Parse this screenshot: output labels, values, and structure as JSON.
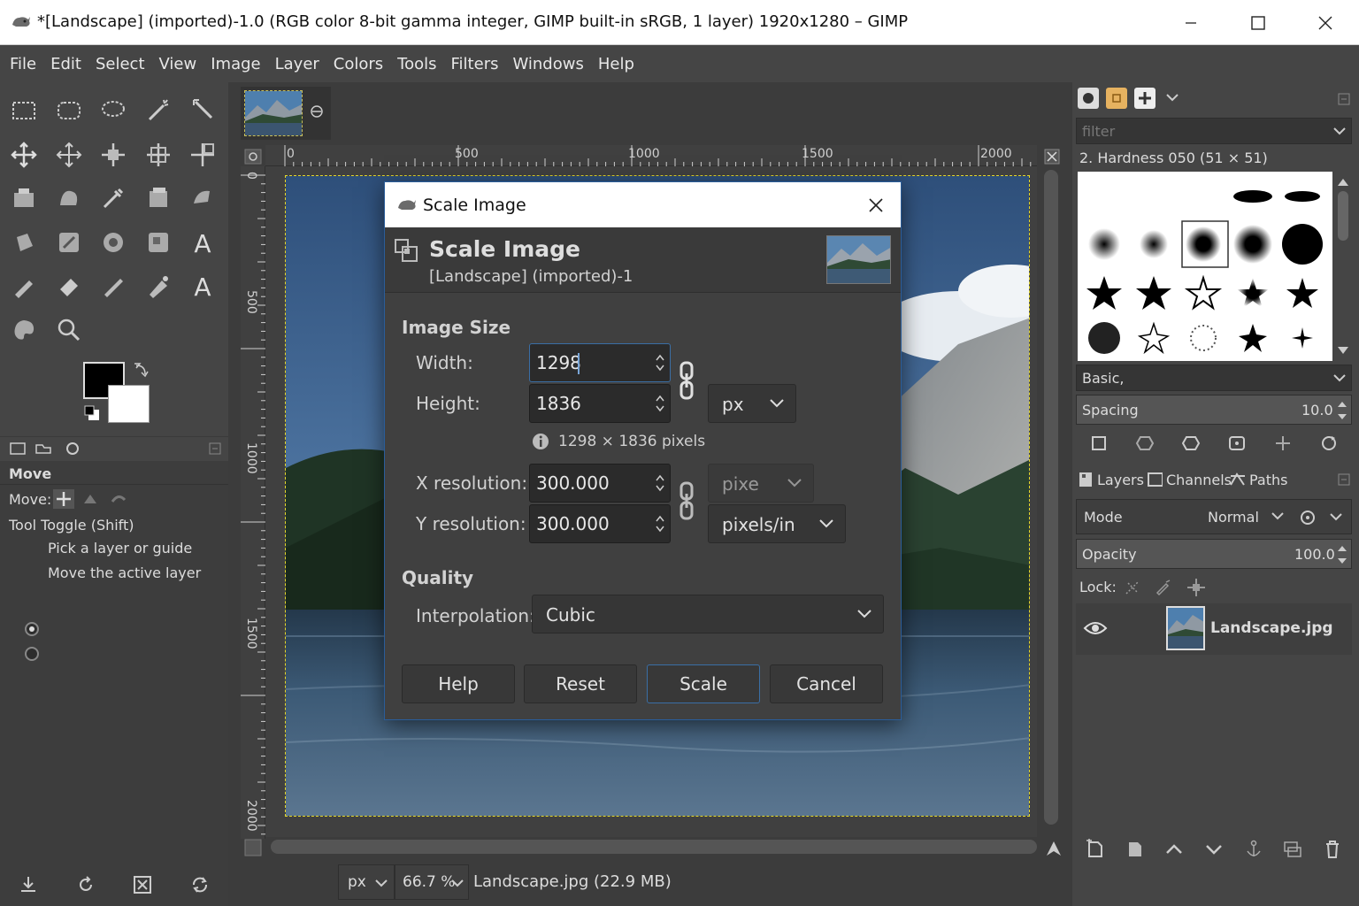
{
  "window": {
    "title": "*[Landscape] (imported)-1.0 (RGB color 8-bit gamma integer, GIMP built-in sRGB, 1 layer) 1920x1280 – GIMP"
  },
  "menu": [
    "File",
    "Edit",
    "Select",
    "View",
    "Image",
    "Layer",
    "Colors",
    "Tools",
    "Filters",
    "Windows",
    "Help"
  ],
  "tool_options": {
    "title": "Move",
    "move_label": "Move:",
    "toggle_label": "Tool Toggle (Shift)",
    "options": [
      {
        "label": "Pick a layer or guide",
        "selected": true
      },
      {
        "label": "Move the active layer",
        "selected": false
      }
    ]
  },
  "ruler": {
    "h_labels": [
      "0",
      "500",
      "1000",
      "1500",
      "2000"
    ],
    "v_labels": [
      "0",
      "500",
      "1000",
      "1500",
      "2000"
    ]
  },
  "status": {
    "unit": "px",
    "zoom": "66.7 %",
    "file_info": "Landscape.jpg (22.9 MB)"
  },
  "brushes": {
    "filter_placeholder": "filter",
    "current_brush": "2. Hardness 050 (51 × 51)",
    "preset": "Basic,",
    "spacing_label": "Spacing",
    "spacing_value": "10.0"
  },
  "layers": {
    "tabs": [
      {
        "label": "Layers",
        "icon": "layers-icon"
      },
      {
        "label": "Channels",
        "icon": "channels-icon"
      },
      {
        "label": "Paths",
        "icon": "paths-icon"
      }
    ],
    "mode_label": "Mode",
    "mode_value": "Normal",
    "opacity_label": "Opacity",
    "opacity_value": "100.0",
    "lock_label": "Lock:",
    "items": [
      {
        "name": "Landscape.jpg",
        "visible": true
      }
    ]
  },
  "dialog": {
    "window_title": "Scale Image",
    "header_title": "Scale Image",
    "header_subtitle": "[Landscape] (imported)-1",
    "image_size_label": "Image Size",
    "width_label": "Width:",
    "width_value": "1298",
    "height_label": "Height:",
    "height_value": "1836",
    "size_unit": "px",
    "pixel_info": "1298 × 1836 pixels",
    "xres_label": "X resolution:",
    "xres_value": "300.000",
    "yres_label": "Y resolution:",
    "yres_value": "300.000",
    "res_unit_truncated": "pixe",
    "res_unit": "pixels/in",
    "quality_label": "Quality",
    "interpolation_label": "Interpolation:",
    "interpolation_value": "Cubic",
    "buttons": {
      "help": "Help",
      "reset": "Reset",
      "scale": "Scale",
      "cancel": "Cancel"
    }
  },
  "colors": {
    "accent_border": "#2a5d9a",
    "selection_marching_ants": "#e5d92a",
    "foreground": "#000000",
    "background": "#ffffff"
  }
}
